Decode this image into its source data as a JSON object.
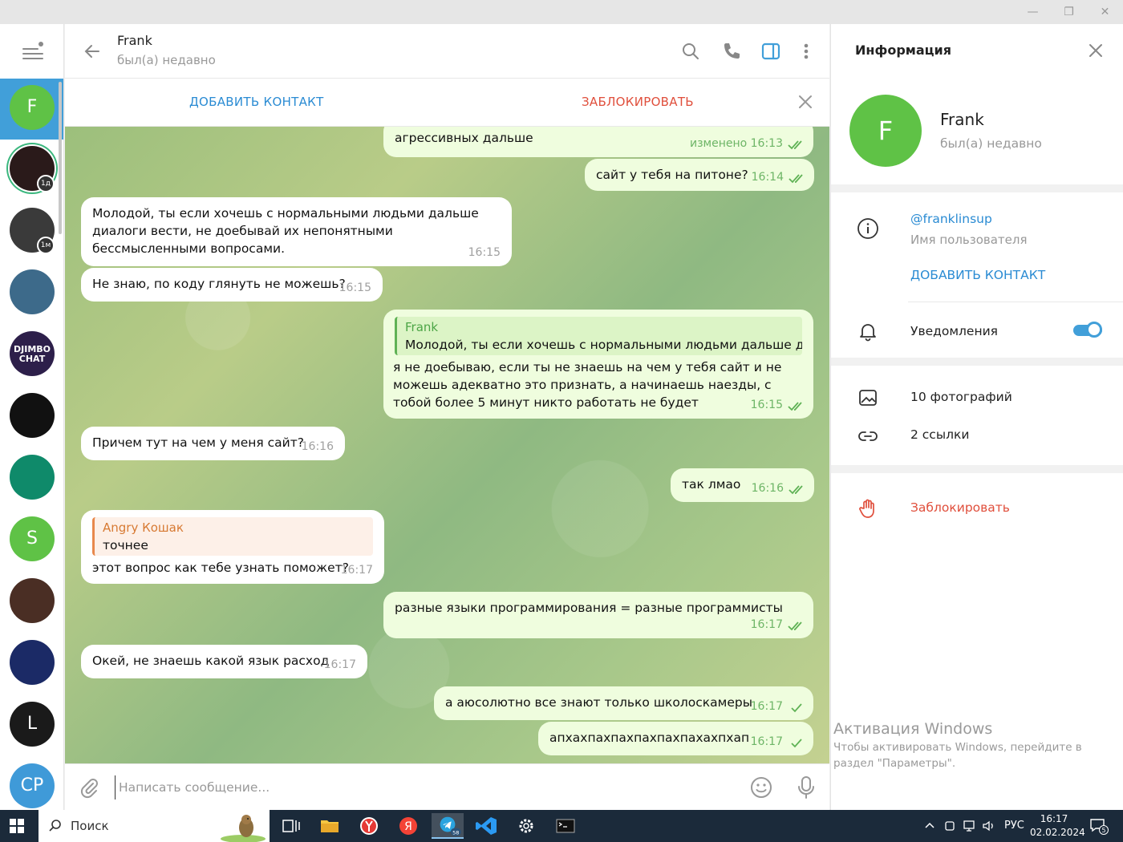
{
  "window": {
    "minimize_glyph": "—",
    "maximize_glyph": "❐",
    "close_glyph": "✕"
  },
  "rail": {
    "active_initial": "F",
    "avatars": [
      {
        "initial": "F",
        "color": "#5fc246",
        "badge": ""
      },
      {
        "initial": "",
        "color": "#2a1a1a",
        "badge": "1д"
      },
      {
        "initial": "",
        "color": "#3a3a3a",
        "badge": "1м"
      },
      {
        "initial": "",
        "color": "#3d6a8a",
        "badge": ""
      },
      {
        "initial": "DJIMBO CHAT",
        "color": "#2d1f4a",
        "badge": ""
      },
      {
        "initial": "",
        "color": "#111111",
        "badge": ""
      },
      {
        "initial": "",
        "color": "#0f8a6a",
        "badge": ""
      },
      {
        "initial": "S",
        "color": "#5fc246",
        "badge": ""
      },
      {
        "initial": "",
        "color": "#4a2e24",
        "badge": ""
      },
      {
        "initial": "",
        "color": "#1b2a66",
        "badge": ""
      },
      {
        "initial": "L",
        "color": "#1a1a1a",
        "badge": ""
      },
      {
        "initial": "CP",
        "color": "#3f9ad8",
        "badge": ""
      }
    ]
  },
  "header": {
    "name": "Frank",
    "status": "был(а) недавно"
  },
  "action_bar": {
    "add_contact": "ДОБАВИТЬ КОНТАКТ",
    "block": "ЗАБЛОКИРОВАТЬ"
  },
  "messages": [
    {
      "side": "out",
      "text": "агрессивных дальше",
      "time": "изменено 16:13",
      "read": true
    },
    {
      "side": "out",
      "text": "сайт у тебя на питоне?",
      "time": "16:14",
      "read": true
    },
    {
      "side": "in",
      "text": "Молодой, ты если хочешь с нормальными людьми дальше диалоги вести, не доебывай их непонятными бессмысленными вопросами.",
      "time": "16:15"
    },
    {
      "side": "in",
      "text": "Не знаю, по коду глянуть не можешь?",
      "time": "16:15"
    },
    {
      "side": "out",
      "reply_name": "Frank",
      "reply_text": "Молодой, ты если хочешь с нормальными людьми дальше д...",
      "text": "я не доебываю, если ты не знаешь на чем у тебя сайт и не можешь адекватно это признать, а начинаешь наезды, с тобой более 5 минут никто работать не будет",
      "time": "16:15",
      "read": true
    },
    {
      "side": "in",
      "text": "Причем тут на чем у меня сайт?",
      "time": "16:16"
    },
    {
      "side": "out",
      "text": "так лмао",
      "time": "16:16",
      "read": true
    },
    {
      "side": "in",
      "reply_name": "Angry Кошак",
      "reply_text": "точнее",
      "text": "этот вопрос как тебе узнать поможет?",
      "time": "16:17"
    },
    {
      "side": "out",
      "text": "разные языки программирования = разные программисты",
      "time": "16:17",
      "read": true
    },
    {
      "side": "in",
      "text": "Окей, не знаешь какой язык расход",
      "time": "16:17"
    },
    {
      "side": "out",
      "text": "а аюсолютно все знают только школоскамеры",
      "time": "16:17",
      "read": false
    },
    {
      "side": "out",
      "text": "апхахпахпахпахпахпахахпхап",
      "time": "16:17",
      "read": false
    }
  ],
  "composer": {
    "placeholder": "Написать сообщение..."
  },
  "info": {
    "title": "Информация",
    "avatar_initial": "F",
    "name": "Frank",
    "status": "был(а) недавно",
    "username": "@franklinsup",
    "username_label": "Имя пользователя",
    "add_contact": "ДОБАВИТЬ КОНТАКТ",
    "notifications_label": "Уведомления",
    "notifications_on": true,
    "photos": "10 фотографий",
    "links": "2 ссылки",
    "block": "Заблокировать"
  },
  "activation": {
    "title": "Активация Windows",
    "line1": "Чтобы активировать Windows, перейдите в",
    "line2": "раздел \"Параметры\"."
  },
  "taskbar": {
    "search_label": "Поиск",
    "telegram_badge": "58",
    "language": "РУС",
    "time": "16:17",
    "date": "02.02.2024",
    "notifications_count": "5"
  },
  "colors": {
    "accent": "#419fd9",
    "link": "#2a8bd3",
    "danger": "#e04f3c",
    "outgoing_bubble": "#effdde",
    "incoming_bubble": "#ffffff"
  }
}
